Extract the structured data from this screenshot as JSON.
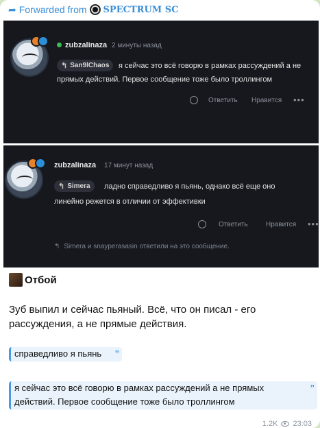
{
  "forwarded": {
    "prefix": "Forwarded from",
    "channel": "SPECTRUM SC"
  },
  "shot1": {
    "username": "zubzalinaza",
    "time": "2 минуты назад",
    "reply_to": "San9lChaos",
    "text_line1": "я сейчас это всё говорю в рамках рассуждений а не",
    "text_line2": "прямых действий. Первое сообщение тоже было троллингом",
    "reply_action": "Ответить",
    "like_action": "Нравится",
    "more": "•••"
  },
  "shot2": {
    "username": "zubzalinaza",
    "time": "17 минут назад",
    "reply_to": "Simera",
    "text_line1": "ладно справедливо я пьянь, однако всё еще оно",
    "text_line2": "линейно режется в отличии от эффективки",
    "reply_action": "Ответить",
    "like_action": "Нравится",
    "more": "•••",
    "reply_note": "Simera и snayperasasin ответили на это сообщение."
  },
  "message": {
    "title": "Отбой",
    "body": "Зуб выпил и сейчас пьяный. Всё, что он писал - его рассуждения, а не прямые действия.",
    "quote1": "справедливо я пьянь",
    "quote2": "я сейчас это всё говорю в рамках рассуждений а не прямых действий. Первое сообщение тоже было троллингом",
    "quote_mark": "”",
    "views": "1.2K",
    "time": "23:03"
  },
  "colors": {
    "accent": "#3a8fd6",
    "dark_bg": "#16181e",
    "online": "#3cbb55",
    "chat_bg": "#d3e5c4"
  },
  "icons": [
    "forward-arrow-icon",
    "channel-logo-icon",
    "reply-arrow-icon",
    "emoji-react-icon",
    "more-icon",
    "eye-icon"
  ]
}
